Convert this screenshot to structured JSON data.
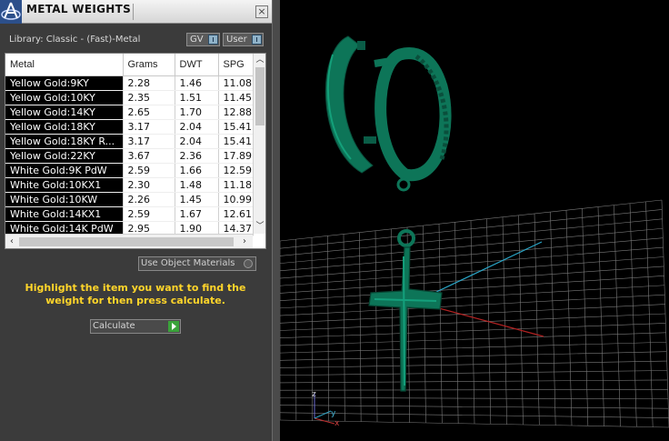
{
  "window": {
    "title": "METAL WEIGHTS",
    "close_glyph": "×"
  },
  "library": {
    "label": "Library: Classic - (Fast)-Metal",
    "gv_toggle": "GV",
    "user_toggle": "User"
  },
  "table": {
    "headers": [
      "Metal",
      "Grams",
      "DWT",
      "SPG"
    ],
    "rows": [
      [
        "Yellow Gold:9KY",
        "2.28",
        "1.46",
        "11.08"
      ],
      [
        "Yellow Gold:10KY",
        "2.35",
        "1.51",
        "11.45"
      ],
      [
        "Yellow Gold:14KY",
        "2.65",
        "1.70",
        "12.88"
      ],
      [
        "Yellow Gold:18KY",
        "3.17",
        "2.04",
        "15.41"
      ],
      [
        "Yellow Gold:18KY R...",
        "3.17",
        "2.04",
        "15.41"
      ],
      [
        "Yellow Gold:22KY",
        "3.67",
        "2.36",
        "17.89"
      ],
      [
        "White Gold:9K PdW",
        "2.59",
        "1.66",
        "12.59"
      ],
      [
        "White Gold:10KX1",
        "2.30",
        "1.48",
        "11.18"
      ],
      [
        "White Gold:10KW",
        "2.26",
        "1.45",
        "10.99"
      ],
      [
        "White Gold:14KX1",
        "2.59",
        "1.67",
        "12.61"
      ],
      [
        "White Gold:14K PdW",
        "2.95",
        "1.90",
        "14.37"
      ]
    ]
  },
  "options": {
    "use_object_materials": "Use Object Materials"
  },
  "instructions": "Highlight the item you want to find the weight for then press calculate.",
  "calculate_button": "Calculate",
  "viewport": {
    "axis_x": "x",
    "axis_y": "y",
    "axis_z": "z",
    "model_color": "#0b6b52"
  }
}
